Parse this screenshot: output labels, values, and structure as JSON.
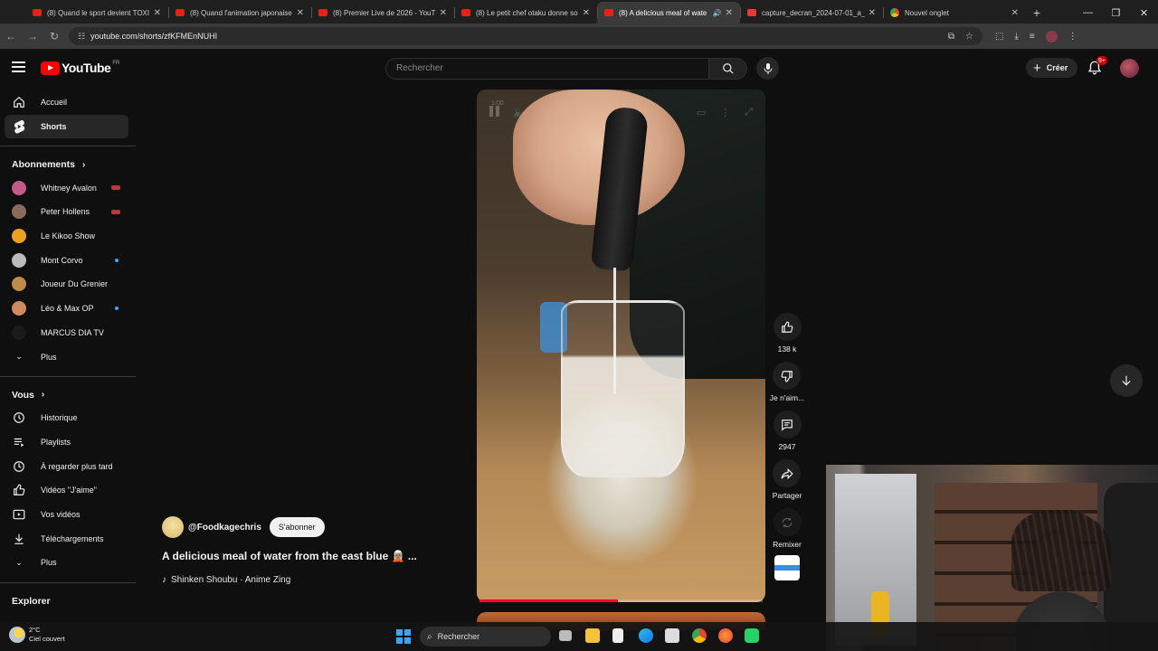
{
  "browser": {
    "tabs": [
      {
        "label": "(8) Quand le sport devient TOXI",
        "icon": "youtube-icon",
        "active": false
      },
      {
        "label": "(8) Quand l'animation japonaise",
        "icon": "youtube-icon",
        "active": false
      },
      {
        "label": "(8) Premier Live de 2026 - YouT",
        "icon": "youtube-icon",
        "active": false
      },
      {
        "label": "(8) Le petit chef otaku donne so",
        "icon": "youtube-icon",
        "active": false
      },
      {
        "label": "(8) A delicious meal of wate",
        "icon": "youtube-icon",
        "active": true
      },
      {
        "label": "capture_decran_2024-07-01_a_",
        "icon": "pdf-icon",
        "active": false
      },
      {
        "label": "Nouvel onglet",
        "icon": "chrome-icon",
        "active": false
      }
    ],
    "url": "youtube.com/shorts/zfKFMEnNUHI"
  },
  "header": {
    "logo_text": "YouTube",
    "logo_country": "FR",
    "search_placeholder": "Rechercher",
    "create_label": "Créer",
    "notifications_count": "9+"
  },
  "sidebar": {
    "main": [
      {
        "label": "Accueil",
        "icon": "home-icon"
      },
      {
        "label": "Shorts",
        "icon": "shorts-icon",
        "active": true
      }
    ],
    "subscriptions_heading": "Abonnements",
    "subscriptions": [
      {
        "label": "Whitney Avalon",
        "status": "live",
        "color": "#c45a8a"
      },
      {
        "label": "Peter Hollens",
        "status": "live",
        "color": "#8a6a5a"
      },
      {
        "label": "Le Kikoo Show",
        "status": "",
        "color": "#f0a020"
      },
      {
        "label": "Mont Corvo",
        "status": "new",
        "color": "#bbbbbb"
      },
      {
        "label": "Joueur Du Grenier",
        "status": "",
        "color": "#c08a4a"
      },
      {
        "label": "Léo & Max OP",
        "status": "new",
        "color": "#d08a60"
      },
      {
        "label": "MARCUS DIA TV",
        "status": "",
        "color": "#1a1a1a"
      }
    ],
    "more_label_1": "Plus",
    "you_heading": "Vous",
    "you_items": [
      {
        "label": "Historique",
        "icon": "history-icon"
      },
      {
        "label": "Playlists",
        "icon": "playlists-icon"
      },
      {
        "label": "À regarder plus tard",
        "icon": "watch-later-icon"
      },
      {
        "label": "Vidéos \"J'aime\"",
        "icon": "thumbs-up-icon"
      },
      {
        "label": "Vos vidéos",
        "icon": "your-videos-icon"
      },
      {
        "label": "Téléchargements",
        "icon": "download-icon"
      }
    ],
    "more_label_2": "Plus",
    "explore_heading": "Explorer"
  },
  "short": {
    "time": "1:00",
    "channel": "@Foodkagechris",
    "subscribe_label": "S'abonner",
    "title": "A delicious meal of water from the east blue 🧝🏽 ...",
    "music": "Shinken Shoubu · Anime Zing",
    "progress": 0.49
  },
  "actions": {
    "likes": "138 k",
    "dislike_label": "Je n'aim...",
    "comments": "2947",
    "share_label": "Partager",
    "remix_label": "Remixer"
  },
  "taskbar": {
    "temperature": "2°C",
    "weather": "Ciel couvert",
    "search_label": "Rechercher"
  }
}
